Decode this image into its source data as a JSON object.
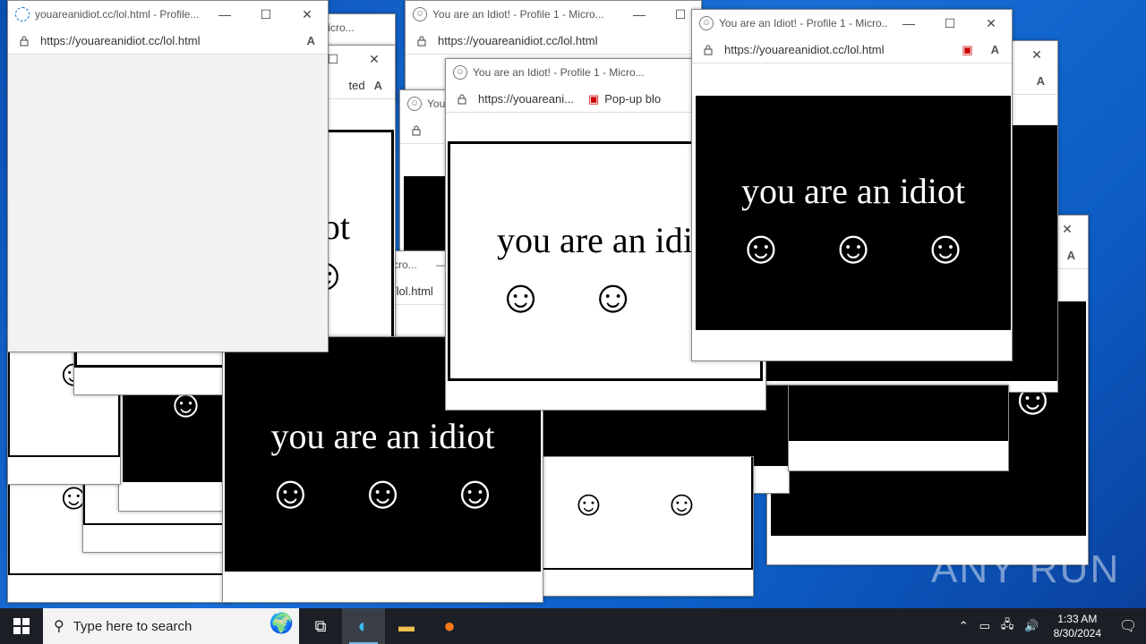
{
  "windows": {
    "title_loading": "youareanidiot.cc/lol.html - Profile...",
    "title_idiot": "You are an Idiot! - Profile 1 - Micro...",
    "title_short": "You are an Idiot! - Profile 1 - Micro...",
    "title_partial1": "1 - Micro...",
    "title_partial2": "cro...",
    "title_partial3": "You",
    "url_full": "https://youareanidiot.cc/lol.html",
    "url_trunc": "https://youareani...",
    "url_partial": "/lol.html",
    "url_partial_ted": "ted",
    "popup_blocked": "Pop-up blo",
    "minimize": "—",
    "maximize": "☐",
    "close": "✕"
  },
  "content": {
    "idiot_text": "you are an idiot",
    "idiot_partial": "iot",
    "idiot_short": "you are an idi",
    "smile": "☺"
  },
  "taskbar": {
    "search_placeholder": "Type here to search",
    "time": "1:33 AM",
    "date": "8/30/2024"
  },
  "watermark": "ANY RUN",
  "colors": {
    "desktop": "#0c5cc4",
    "taskbar": "#1c2026",
    "panel_black": "#000000",
    "panel_white": "#ffffff"
  }
}
